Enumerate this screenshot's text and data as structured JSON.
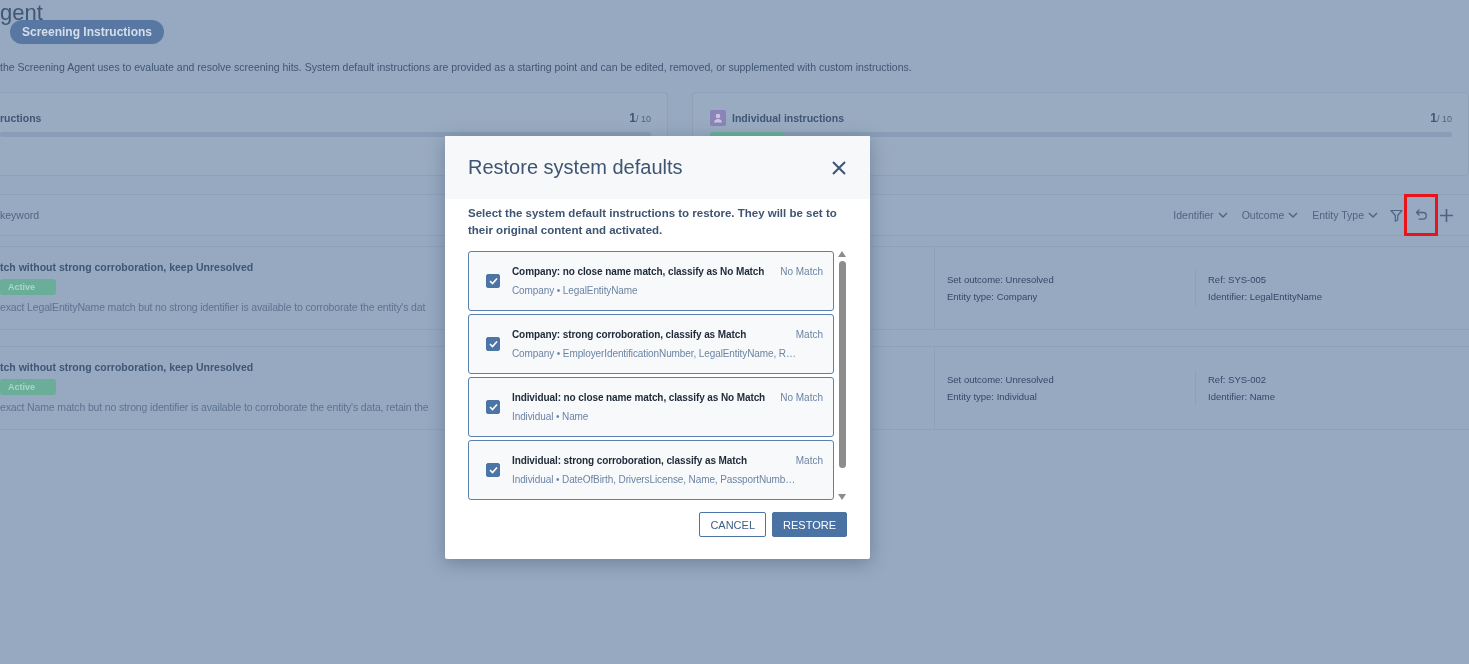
{
  "page": {
    "title": "gent",
    "tabs": [
      {
        "label": "Screening Instructions",
        "selected": true
      }
    ],
    "description": "the Screening Agent uses to evaluate and resolve screening hits. System default instructions are provided as a starting point and can be edited, removed, or supplemented with custom instructions."
  },
  "summary_cards": [
    {
      "kind": "plain",
      "title": "ructions",
      "count": "1",
      "total": "/ 10"
    },
    {
      "kind": "person",
      "title": "Individual instructions",
      "count": "1",
      "total": "/ 10",
      "level": 0.1
    }
  ],
  "toolbar": {
    "search": {
      "placeholder": "keyword"
    },
    "filters": [
      "Identifier",
      "Outcome",
      "Entity Type"
    ],
    "restore_highlighted": true
  },
  "instructions": [
    {
      "title": "tch without strong corroboration, keep Unresolved",
      "status": "Active",
      "description": "exact LegalEntityName match but no strong identifier is available to corroborate the entity's dat",
      "outcome": "Set outcome: Unresolved",
      "entity_type": "Entity type: Company",
      "ref": "Ref: SYS-005",
      "identifier": "Identifier: LegalEntityName"
    },
    {
      "title": "tch without strong corroboration, keep Unresolved",
      "status": "Active",
      "description": "exact Name match but no strong identifier is available to corroborate the entity's data, retain the",
      "outcome": "Set outcome: Unresolved",
      "entity_type": "Entity type: Individual",
      "ref": "Ref: SYS-002",
      "identifier": "Identifier: Name"
    }
  ],
  "dialog": {
    "title": "Restore system defaults",
    "message": "Select the system default instructions to restore. They will be set to their original content and activated.",
    "items": [
      {
        "title": "Company: no close name match, classify as No Match",
        "outcome": "No Match",
        "meta": "Company • LegalEntityName",
        "checked": true
      },
      {
        "title": "Company: strong corroboration, classify as Match",
        "outcome": "Match",
        "meta": "Company • EmployerIdentificationNumber, LegalEntityName, R…",
        "checked": true
      },
      {
        "title": "Individual: no close name match, classify as No Match",
        "outcome": "No Match",
        "meta": "Individual • Name",
        "checked": true
      },
      {
        "title": "Individual: strong corroboration, classify as Match",
        "outcome": "Match",
        "meta": "Individual • DateOfBirth, DriversLicense, Name, PassportNumb…",
        "checked": true
      }
    ],
    "buttons": [
      {
        "label": "CANCEL",
        "kind": "secondary"
      },
      {
        "label": "RESTORE",
        "kind": "primary"
      }
    ]
  }
}
